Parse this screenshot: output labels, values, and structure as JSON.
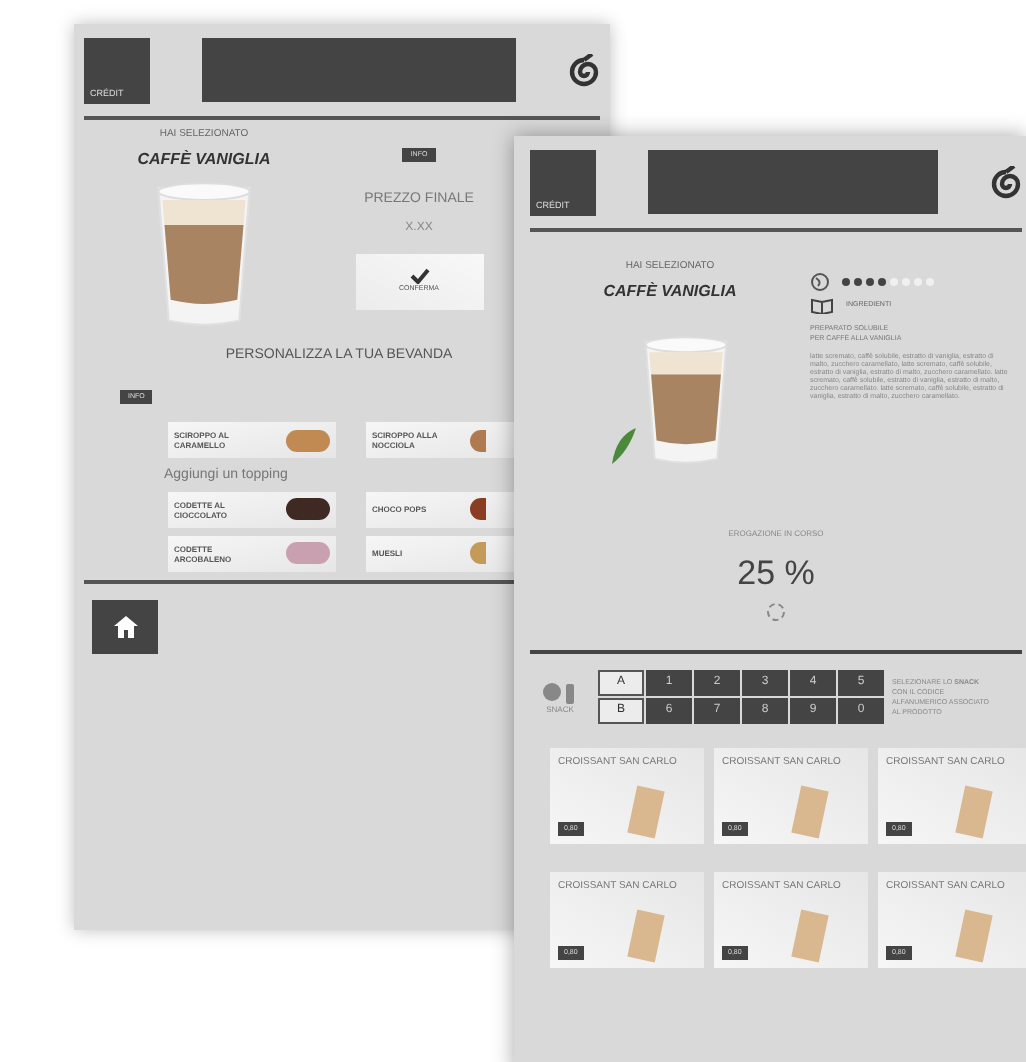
{
  "back_screen": {
    "credit_label": "CRÉDIT",
    "selected_label": "HAI SELEZIONATO",
    "product": "CAFFÈ VANIGLIA",
    "info_badge": "INFO",
    "price_label": "PREZZO FINALE",
    "price": "X.XX",
    "confirm": "CONFERMA",
    "customize_title": "PERSONALIZZA LA TUA BEVANDA",
    "customize_info": "INFO",
    "syrups": [
      {
        "name": "SCIROPPO AL CARAMELLO",
        "color": "#c08a52"
      },
      {
        "name": "SCIROPPO ALLA NOCCIOLA",
        "color": "#b07a50"
      }
    ],
    "topping_title": "Aggiungi un topping",
    "toppings": [
      {
        "name": "CODETTE AL CIOCCOLATO",
        "color": "#3e2a22"
      },
      {
        "name": "CHOCO POPS",
        "color": "#8a3d22"
      },
      {
        "name": "CODETTE ARCOBALENO",
        "color": "#c9a0b0"
      },
      {
        "name": "MUESLI",
        "color": "#c49a58"
      }
    ]
  },
  "front_screen": {
    "credit_label": "CRÉDIT",
    "selected_label": "HAI SELEZIONATO",
    "product": "CAFFÈ VANIGLIA",
    "stars": 4,
    "ingredients_label": "INGREDIENTI",
    "preparation": "PREPARATO SOLUBILE PER CAFFÈ ALLA VANIGLIA",
    "ingredients": "latte scremato, caffè solubile, estratto di vaniglia, estratto di malto, zucchero caramellato, latte scremato, caffè solubile, estratto di vaniglia, estratto di malto, zucchero caramellato. latte scremato, caffè solubile, estratto di vaniglia, estratto di malto, zucchero caramellato. latte scremato, caffè solubile, estratto di vaniglia, estratto di malto, zucchero caramellato.",
    "progress_label": "EROGAZIONE IN CORSO",
    "progress": "25 %",
    "snack_label": "SNACK",
    "letters": [
      "A",
      "B"
    ],
    "digits": [
      [
        "1",
        "2",
        "3",
        "4",
        "5"
      ],
      [
        "6",
        "7",
        "8",
        "9",
        "0"
      ]
    ],
    "snack_help": "SELEZIONARE LO **SNACK** CON IL CODICE ALFANUMERICO ASSOCIATO AL PRODOTTO",
    "snacks": [
      {
        "name": "CROISSANT SAN CARLO",
        "price": "0,80"
      },
      {
        "name": "CROISSANT SAN CARLO",
        "price": "0,80"
      },
      {
        "name": "CROISSANT SAN CARLO",
        "price": "0,80"
      },
      {
        "name": "CROISSANT SAN CARLO",
        "price": "0,80"
      },
      {
        "name": "CROISSANT SAN CARLO",
        "price": "0,80"
      },
      {
        "name": "CROISSANT SAN CARLO",
        "price": "0,80"
      }
    ]
  }
}
